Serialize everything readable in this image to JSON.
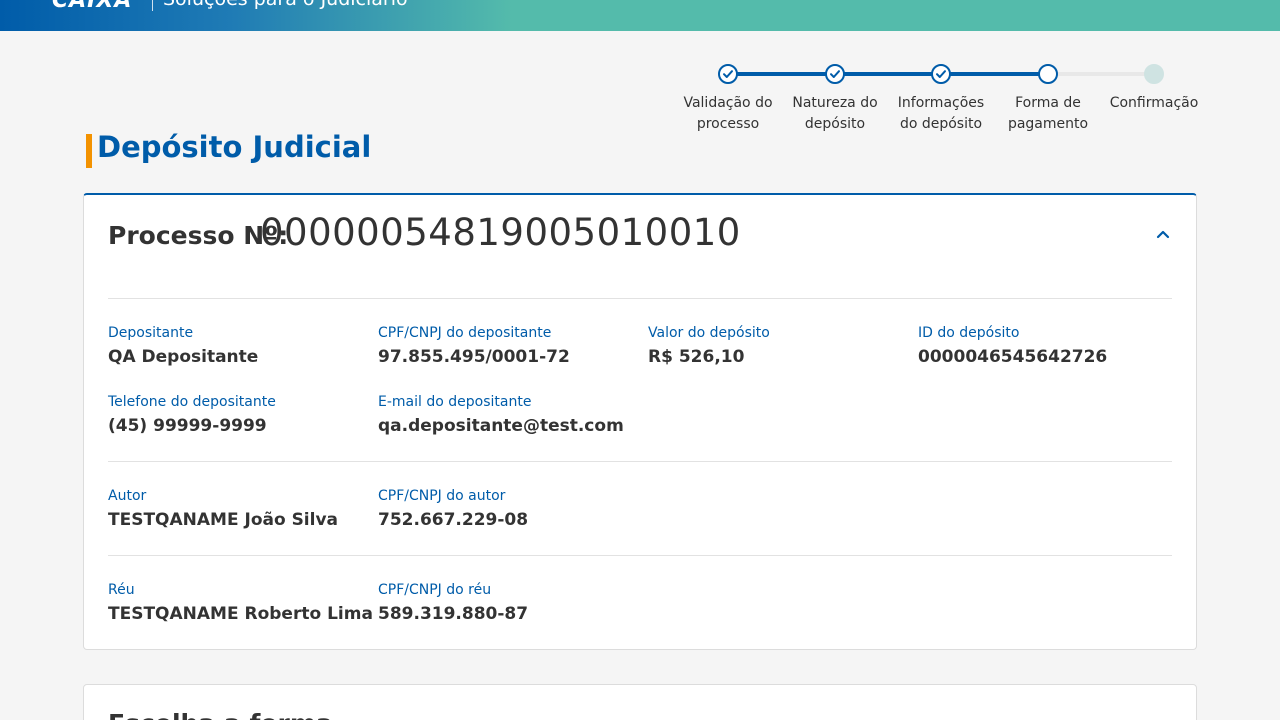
{
  "header": {
    "logo_text": "CAIXA",
    "title": "Soluções para o Judiciário"
  },
  "stepper": {
    "steps": [
      {
        "label": "Validação do processo",
        "state": "done"
      },
      {
        "label": "Natureza do depósito",
        "state": "done"
      },
      {
        "label": "Informações do depósito",
        "state": "done"
      },
      {
        "label": "Forma de pagamento",
        "state": "current"
      },
      {
        "label": "Confirmação",
        "state": "future"
      }
    ]
  },
  "page": {
    "title": "Depósito Judicial"
  },
  "process_card": {
    "label": "Processo Nº:",
    "number": "00000054819005010010",
    "collapse_icon": "chevron-up-icon",
    "depositante": {
      "name_label": "Depositante",
      "name_value": "QA Depositante",
      "doc_label": "CPF/CNPJ do depositante",
      "doc_value": "97.855.495/0001-72",
      "amount_label": "Valor do depósito",
      "amount_value": "R$ 526,10",
      "id_label": "ID do depósito",
      "id_value": "0000046545642726",
      "phone_label": "Telefone do depositante",
      "phone_value": "(45) 99999-9999",
      "email_label": "E-mail do depositante",
      "email_value": "qa.depositante@test.com"
    },
    "autor": {
      "name_label": "Autor",
      "name_value": "TESTQANAME João Silva",
      "doc_label": "CPF/CNPJ do autor",
      "doc_value": "752.667.229-08"
    },
    "reu": {
      "name_label": "Réu",
      "name_value": "TESTQANAME Roberto Lima",
      "doc_label": "CPF/CNPJ do réu",
      "doc_value": "589.319.880-87"
    }
  },
  "second_card": {
    "title": "Escolha a forma",
    "icon": "chevron-up-icon"
  },
  "colors": {
    "primary": "#005ca9",
    "accent": "#f39200",
    "teal": "#54bbab"
  }
}
